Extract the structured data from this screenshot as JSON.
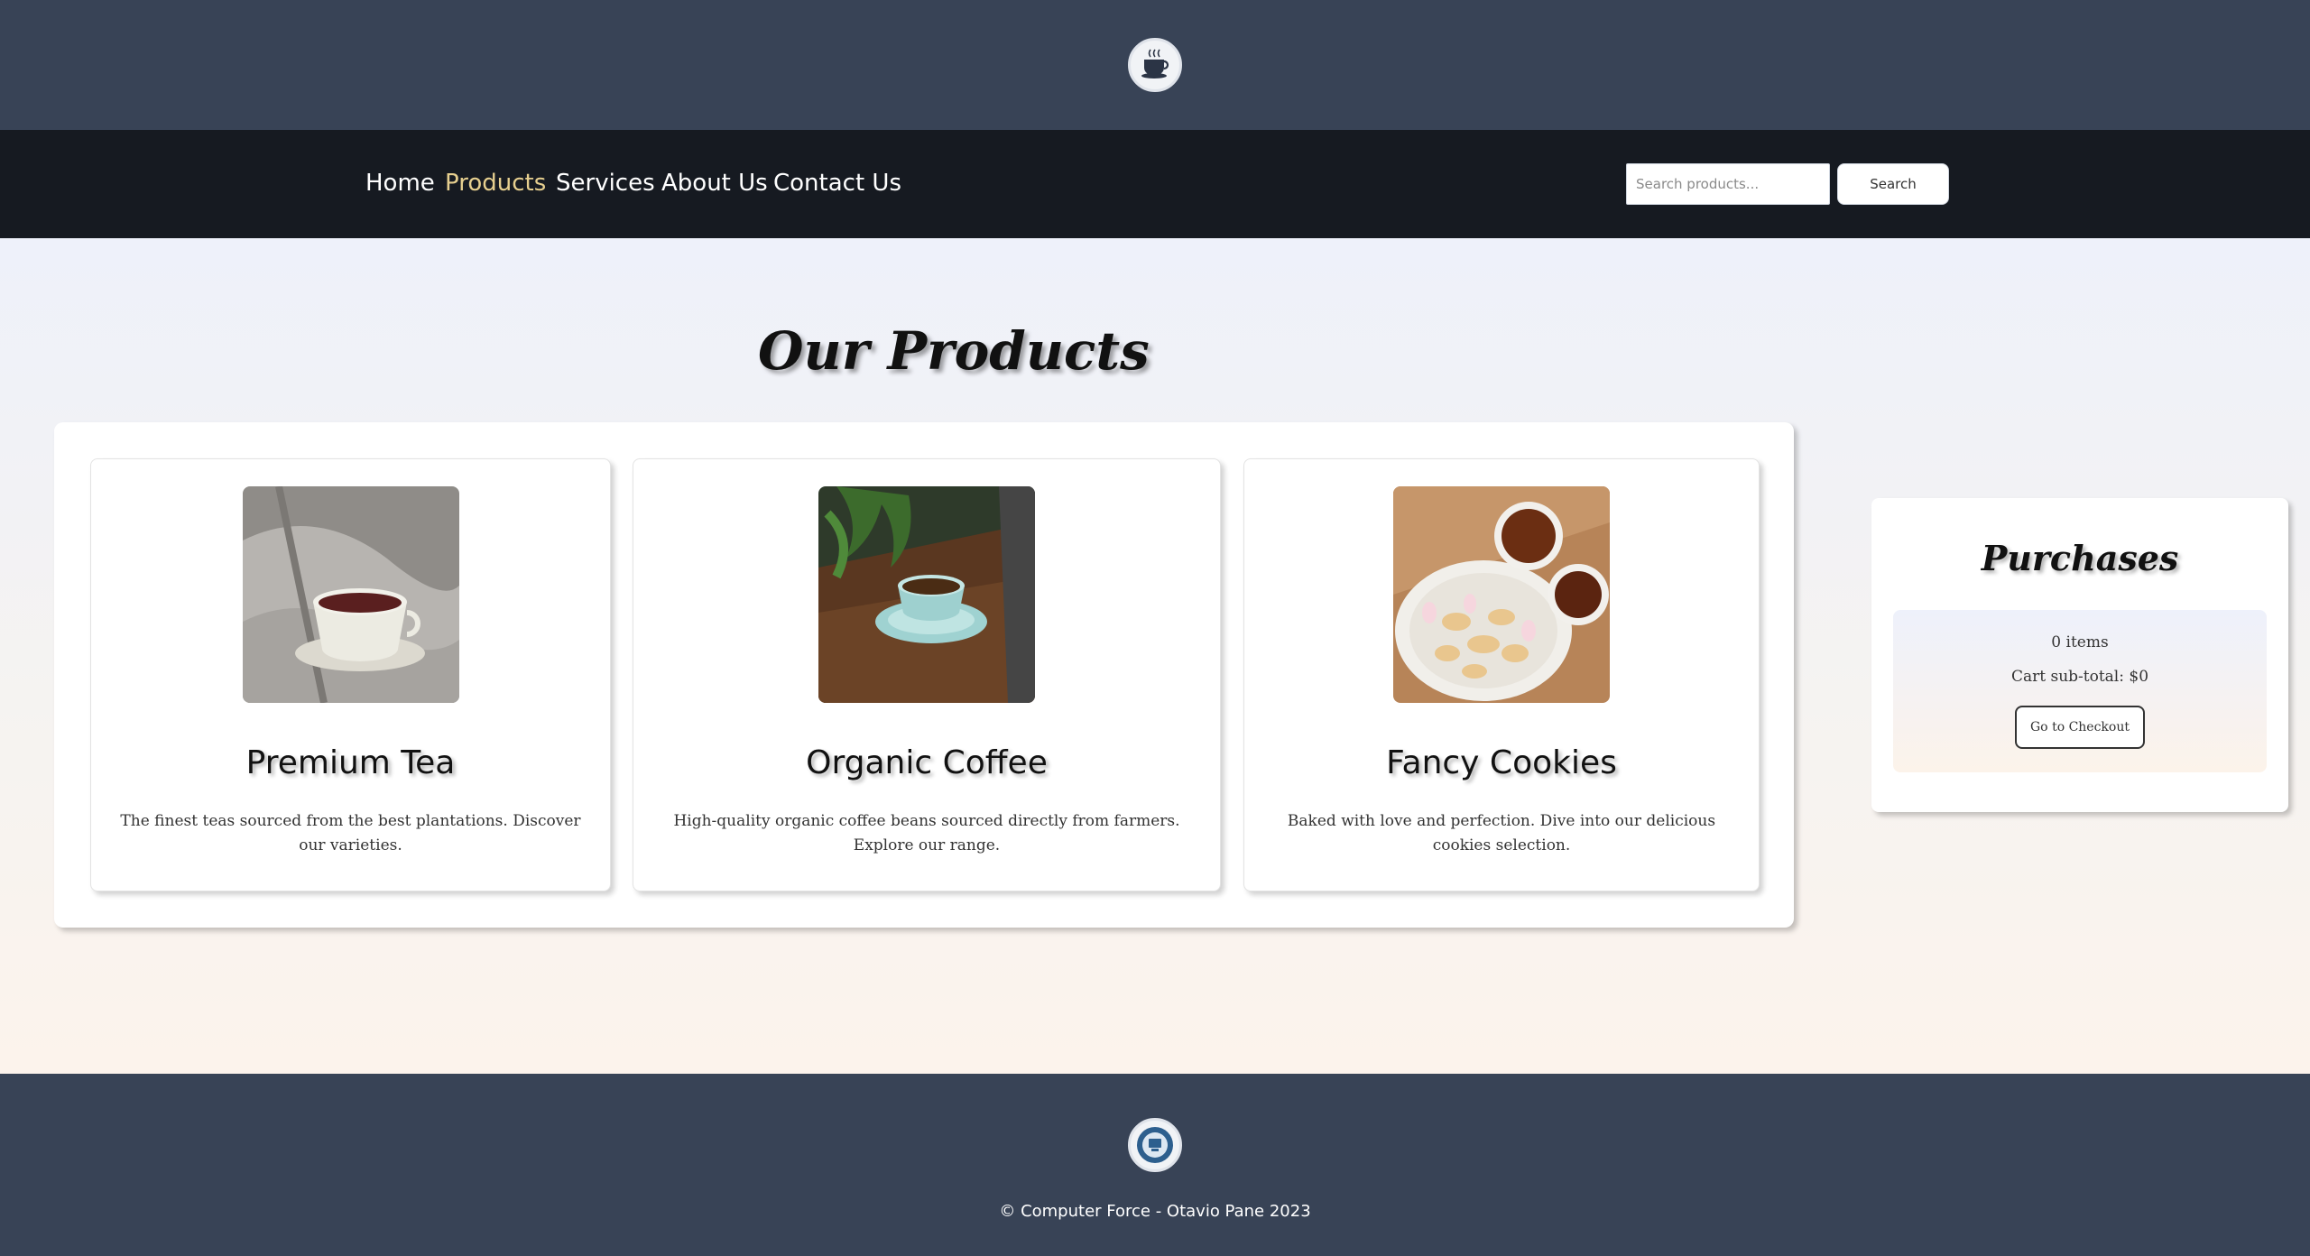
{
  "header": {
    "logo_icon": "coffee-cup-logo-icon"
  },
  "nav": {
    "links": [
      {
        "label": "Home",
        "active": false
      },
      {
        "label": "Products",
        "active": true
      },
      {
        "label": "Services",
        "active": false
      },
      {
        "label": "About Us",
        "active": false
      },
      {
        "label": "Contact Us",
        "active": false
      }
    ],
    "search_placeholder": "Search products...",
    "search_label": "Search",
    "active_color": "#e6cf8f"
  },
  "main": {
    "title": "Our Products",
    "products": [
      {
        "name": "Premium Tea",
        "description": "The finest teas sourced from the best plantations. Discover our varieties.",
        "image": "tea-cup-on-blanket-photo"
      },
      {
        "name": "Organic Coffee",
        "description": "High-quality organic coffee beans sourced directly from farmers. Explore our range.",
        "image": "coffee-cup-on-wooden-table-photo"
      },
      {
        "name": "Fancy Cookies",
        "description": "Baked with love and perfection. Dive into our delicious cookies selection.",
        "image": "cookies-plate-with-tea-cups-photo"
      }
    ]
  },
  "purchases": {
    "title": "Purchases",
    "items": "0 items",
    "subtotal": "Cart sub-total: $0",
    "checkout_label": "Go to Checkout"
  },
  "footer": {
    "logo_icon": "computer-force-emblem-icon",
    "copyright": "© Computer Force - Otavio Pane 2023"
  },
  "colors": {
    "banner": "#384356",
    "navbar": "#161a21",
    "footer": "#384356"
  }
}
